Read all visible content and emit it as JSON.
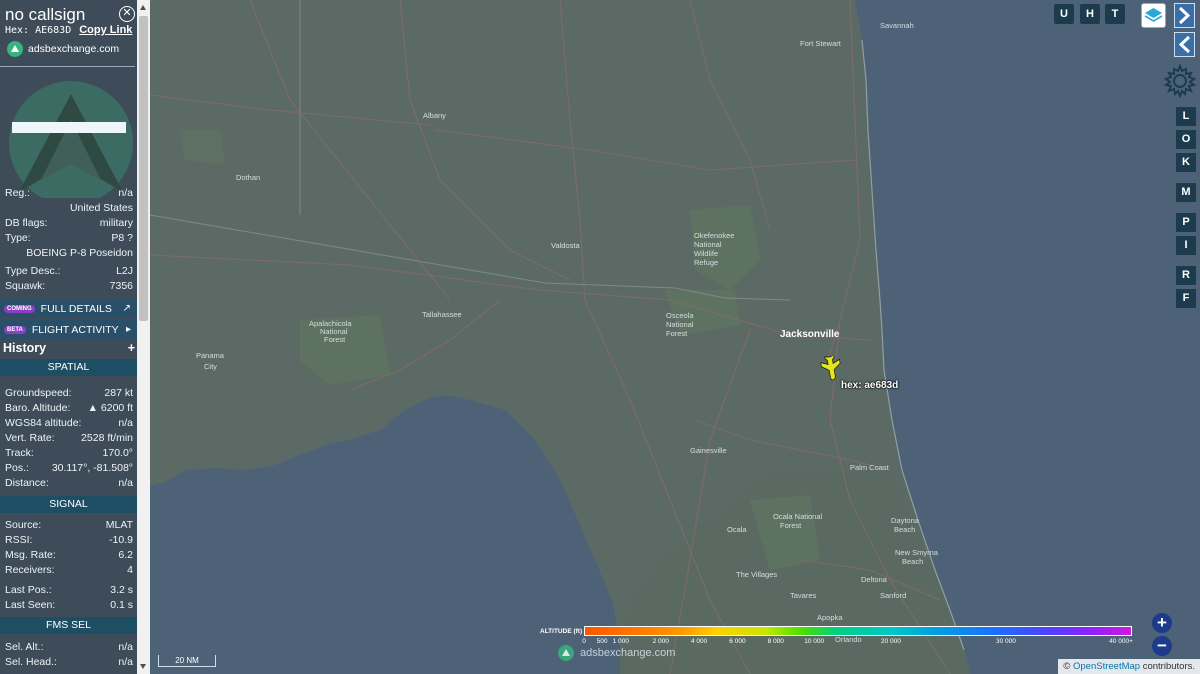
{
  "aircraft": {
    "callsign": "no callsign",
    "hex_line": "Hex: AE683D",
    "copy_link": "Copy Link",
    "brand": "adsbexchange.com",
    "reg_label": "Reg.:",
    "reg_value": "n/a",
    "country": "United States",
    "dbflags_label": "DB flags:",
    "dbflags_value": "military",
    "type_label": "Type:",
    "type_value": "P8 ?",
    "type_name": "BOEING P-8 Poseidon",
    "typedesc_label": "Type Desc.:",
    "typedesc_value": "L2J",
    "squawk_label": "Squawk:",
    "squawk_value": "7356"
  },
  "buttons": {
    "coming_badge": "COMING",
    "full_details": "FULL DETAILS",
    "beta_badge": "BETA",
    "flight_activity": "FLIGHT ACTIVITY",
    "history": "History",
    "history_add": "+"
  },
  "spatial": {
    "header": "SPATIAL",
    "rows": [
      {
        "label": "Groundspeed:",
        "value": "287 kt"
      },
      {
        "label": "Baro. Altitude:",
        "value": "▲ 6200 ft"
      },
      {
        "label": "WGS84 altitude:",
        "value": "n/a"
      },
      {
        "label": "Vert. Rate:",
        "value": "2528 ft/min"
      },
      {
        "label": "Track:",
        "value": "170.0°"
      },
      {
        "label": "Pos.:",
        "value": "30.117°, -81.508°"
      },
      {
        "label": "Distance:",
        "value": "n/a"
      }
    ]
  },
  "signal": {
    "header": "SIGNAL",
    "rows": [
      {
        "label": "Source:",
        "value": "MLAT"
      },
      {
        "label": "RSSI:",
        "value": "-10.9"
      },
      {
        "label": "Msg. Rate:",
        "value": "6.2"
      },
      {
        "label": "Receivers:",
        "value": "4"
      },
      {
        "label": "Last Pos.:",
        "value": "3.2 s"
      },
      {
        "label": "Last Seen:",
        "value": "0.1 s"
      }
    ]
  },
  "fms": {
    "header": "FMS SEL",
    "rows": [
      {
        "label": "Sel. Alt.:",
        "value": "n/a"
      },
      {
        "label": "Sel. Head.:",
        "value": "n/a"
      }
    ]
  },
  "map": {
    "aircraft_label": "hex: ae683d",
    "scale": "20 NM",
    "attribution_prefix": "© ",
    "attribution_link": "OpenStreetMap",
    "attribution_suffix": " contributors.",
    "brand": "adsbexchange.com",
    "places": [
      {
        "name": "Savannah"
      },
      {
        "name": "Fort Stewart"
      },
      {
        "name": "Albany"
      },
      {
        "name": "Dothan"
      },
      {
        "name": "Valdosta"
      },
      {
        "name": "Okefenokee"
      },
      {
        "name": "National"
      },
      {
        "name": "Wildlife"
      },
      {
        "name": "Refuge"
      },
      {
        "name": "Tallahassee"
      },
      {
        "name": "Panama"
      },
      {
        "name": "City"
      },
      {
        "name": "Apalachicola"
      },
      {
        "name": "National"
      },
      {
        "name": "Forest"
      },
      {
        "name": "Jacksonville"
      },
      {
        "name": "Osceola"
      },
      {
        "name": "National"
      },
      {
        "name": "Forest"
      },
      {
        "name": "Gainesville"
      },
      {
        "name": "Palm Coast"
      },
      {
        "name": "Ocala"
      },
      {
        "name": "Ocala National"
      },
      {
        "name": "Forest"
      },
      {
        "name": "Daytona"
      },
      {
        "name": "Beach"
      },
      {
        "name": "New Smyrna"
      },
      {
        "name": "Beach"
      },
      {
        "name": "Deltona"
      },
      {
        "name": "The Villages"
      },
      {
        "name": "Sanford"
      },
      {
        "name": "Tavares"
      },
      {
        "name": "Apopka"
      },
      {
        "name": "Orlando"
      }
    ]
  },
  "altitude_legend": {
    "title": "ALTITUDE (ft)",
    "ticks": [
      {
        "label": "0",
        "pct": 0.0
      },
      {
        "label": "500",
        "pct": 0.033
      },
      {
        "label": "1 000",
        "pct": 0.067
      },
      {
        "label": "2 000",
        "pct": 0.14
      },
      {
        "label": "4 000",
        "pct": 0.21
      },
      {
        "label": "6 000",
        "pct": 0.28
      },
      {
        "label": "8 000",
        "pct": 0.35
      },
      {
        "label": "10 000",
        "pct": 0.42
      },
      {
        "label": "20 000",
        "pct": 0.56
      },
      {
        "label": "30 000",
        "pct": 0.77
      },
      {
        "label": "40 000+",
        "pct": 0.98
      }
    ]
  },
  "controls": {
    "top": [
      "U",
      "H",
      "T"
    ],
    "side": [
      "L",
      "O",
      "K",
      "M",
      "P",
      "I",
      "R",
      "F"
    ],
    "zoom_in": "+",
    "zoom_out": "−"
  }
}
